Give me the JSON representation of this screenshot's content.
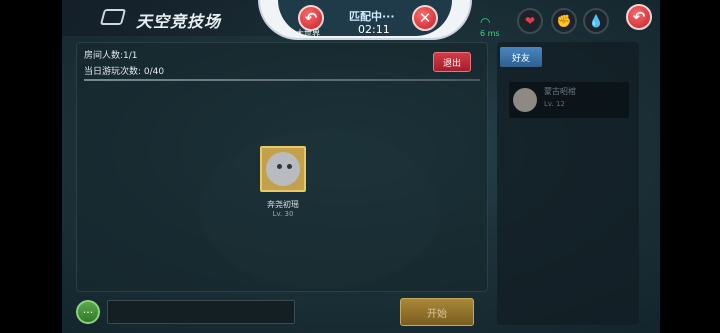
{
  "header": {
    "title": "天空竞技场",
    "status": "匹配中···",
    "timer": "02:11",
    "world_label": "大世界",
    "wifi_label": "6 ms"
  },
  "room": {
    "player_count_label": "房间人数:1/1",
    "play_count_label": "当日游玩次数: 0/40",
    "exit_label": "退出"
  },
  "player": {
    "name": "奔尧初瑶",
    "level": "Lv. 30"
  },
  "friends": {
    "tab_label": "好友",
    "items": [
      {
        "name": "蒙古昭棺",
        "level": "Lv. 12"
      }
    ]
  },
  "bottom": {
    "chat_icon": "···",
    "start_label": "开始"
  },
  "colors": {
    "accent_red": "#c2202a",
    "friend_tab": "#4b86bf",
    "start_gold": "#a9883a"
  },
  "icons": [
    "back-icon",
    "close-icon",
    "heart-icon",
    "fist-icon",
    "drop-icon",
    "wifi-icon",
    "logo-icon"
  ]
}
